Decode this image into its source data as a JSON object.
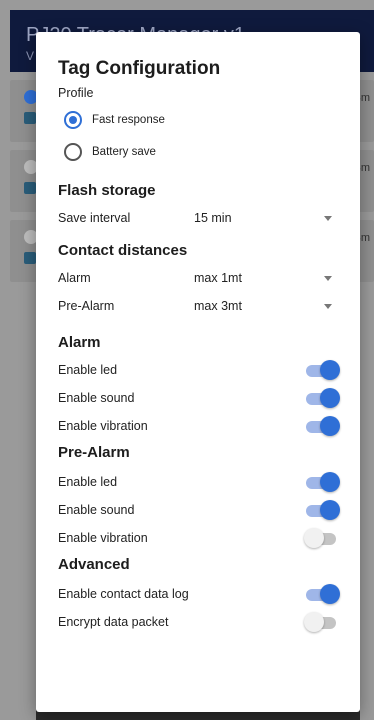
{
  "background_app": {
    "title": "PJ20 Tracer Manager v1",
    "subtitle": "V",
    "menu_icon": "more-vertical-icon",
    "cards": [
      {
        "right_text": "Bm",
        "dot_color": "#2f6fd6"
      },
      {
        "right_text": "Bm",
        "dot_color": "#bdbdbd"
      },
      {
        "right_text": "Bm",
        "dot_color": "#bdbdbd"
      }
    ]
  },
  "dialog": {
    "title": "Tag Configuration",
    "profile": {
      "label": "Profile",
      "options": [
        {
          "label": "Fast response",
          "selected": true
        },
        {
          "label": "Battery save",
          "selected": false
        }
      ]
    },
    "flash_storage": {
      "title": "Flash storage",
      "save_interval": {
        "label": "Save interval",
        "value": "15 min"
      }
    },
    "contact_distances": {
      "title": "Contact distances",
      "alarm": {
        "label": "Alarm",
        "value": "max 1mt"
      },
      "pre_alarm": {
        "label": "Pre-Alarm",
        "value": "max 3mt"
      }
    },
    "alarm": {
      "title": "Alarm",
      "switches": [
        {
          "label": "Enable led",
          "on": true
        },
        {
          "label": "Enable sound",
          "on": true
        },
        {
          "label": "Enable vibration",
          "on": true
        }
      ]
    },
    "pre_alarm": {
      "title": "Pre-Alarm",
      "switches": [
        {
          "label": "Enable led",
          "on": true
        },
        {
          "label": "Enable sound",
          "on": true
        },
        {
          "label": "Enable vibration",
          "on": false
        }
      ]
    },
    "advanced": {
      "title": "Advanced",
      "switches": [
        {
          "label": "Enable contact data log",
          "on": true
        },
        {
          "label": "Encrypt data packet",
          "on": false
        }
      ]
    }
  },
  "colors": {
    "accent": "#2f6fd6",
    "appbar": "#0f1a3d"
  }
}
